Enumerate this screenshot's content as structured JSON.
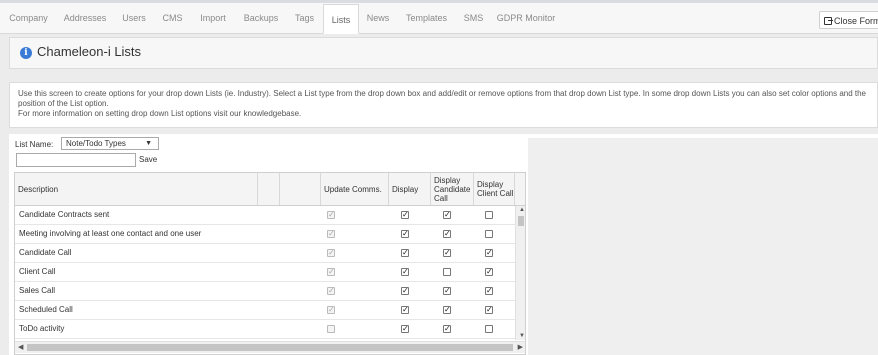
{
  "tabs": [
    {
      "label": "Company"
    },
    {
      "label": "Addresses"
    },
    {
      "label": "Users"
    },
    {
      "label": "CMS"
    },
    {
      "label": "Import"
    },
    {
      "label": "Backups"
    },
    {
      "label": "Tags"
    },
    {
      "label": "Lists"
    },
    {
      "label": "News"
    },
    {
      "label": "Templates"
    },
    {
      "label": "SMS"
    },
    {
      "label": "GDPR Monitor"
    }
  ],
  "active_tab": "Lists",
  "close_button": {
    "label": "Close Form"
  },
  "page_title": "Chameleon-i Lists",
  "info": {
    "line1": "Use this screen to create options for your drop down Lists (ie. Industry). Select a List type from the drop down box and add/edit or remove options from that drop down List type. In some drop down Lists you can also set color options and the position of the List option.",
    "line2": "For more information on setting drop down List options visit our knowledgebase."
  },
  "list_selector": {
    "label": "List Name:",
    "value": "Note/Todo Types"
  },
  "new_option": {
    "value": "",
    "save_label": "Save"
  },
  "columns": {
    "description": "Description",
    "update_comms": "Update Comms.",
    "display": "Display",
    "display_candidate_call": "Display Candidate Call",
    "display_client_call": "Display Client Call"
  },
  "rows": [
    {
      "description": "Candidate Contracts sent",
      "update_comms": true,
      "update_disabled": false,
      "display": true,
      "candidate_call": true,
      "client_call": false
    },
    {
      "description": "Meeting involving at least one contact and one user",
      "update_comms": true,
      "update_disabled": false,
      "display": true,
      "candidate_call": true,
      "client_call": false
    },
    {
      "description": "Candidate Call",
      "update_comms": true,
      "update_disabled": false,
      "display": true,
      "candidate_call": true,
      "client_call": true
    },
    {
      "description": "Client Call",
      "update_comms": true,
      "update_disabled": false,
      "display": true,
      "candidate_call": false,
      "client_call": true
    },
    {
      "description": "Sales Call",
      "update_comms": true,
      "update_disabled": false,
      "display": true,
      "candidate_call": true,
      "client_call": true
    },
    {
      "description": "Scheduled Call",
      "update_comms": true,
      "update_disabled": false,
      "display": true,
      "candidate_call": true,
      "client_call": true
    },
    {
      "description": "ToDo activity",
      "update_comms": false,
      "update_disabled": true,
      "display": true,
      "candidate_call": true,
      "client_call": false
    }
  ],
  "colors": {
    "info_icon": "#3a7bd5",
    "tab_bar": "#f7f7f7",
    "background": "#ececec"
  }
}
